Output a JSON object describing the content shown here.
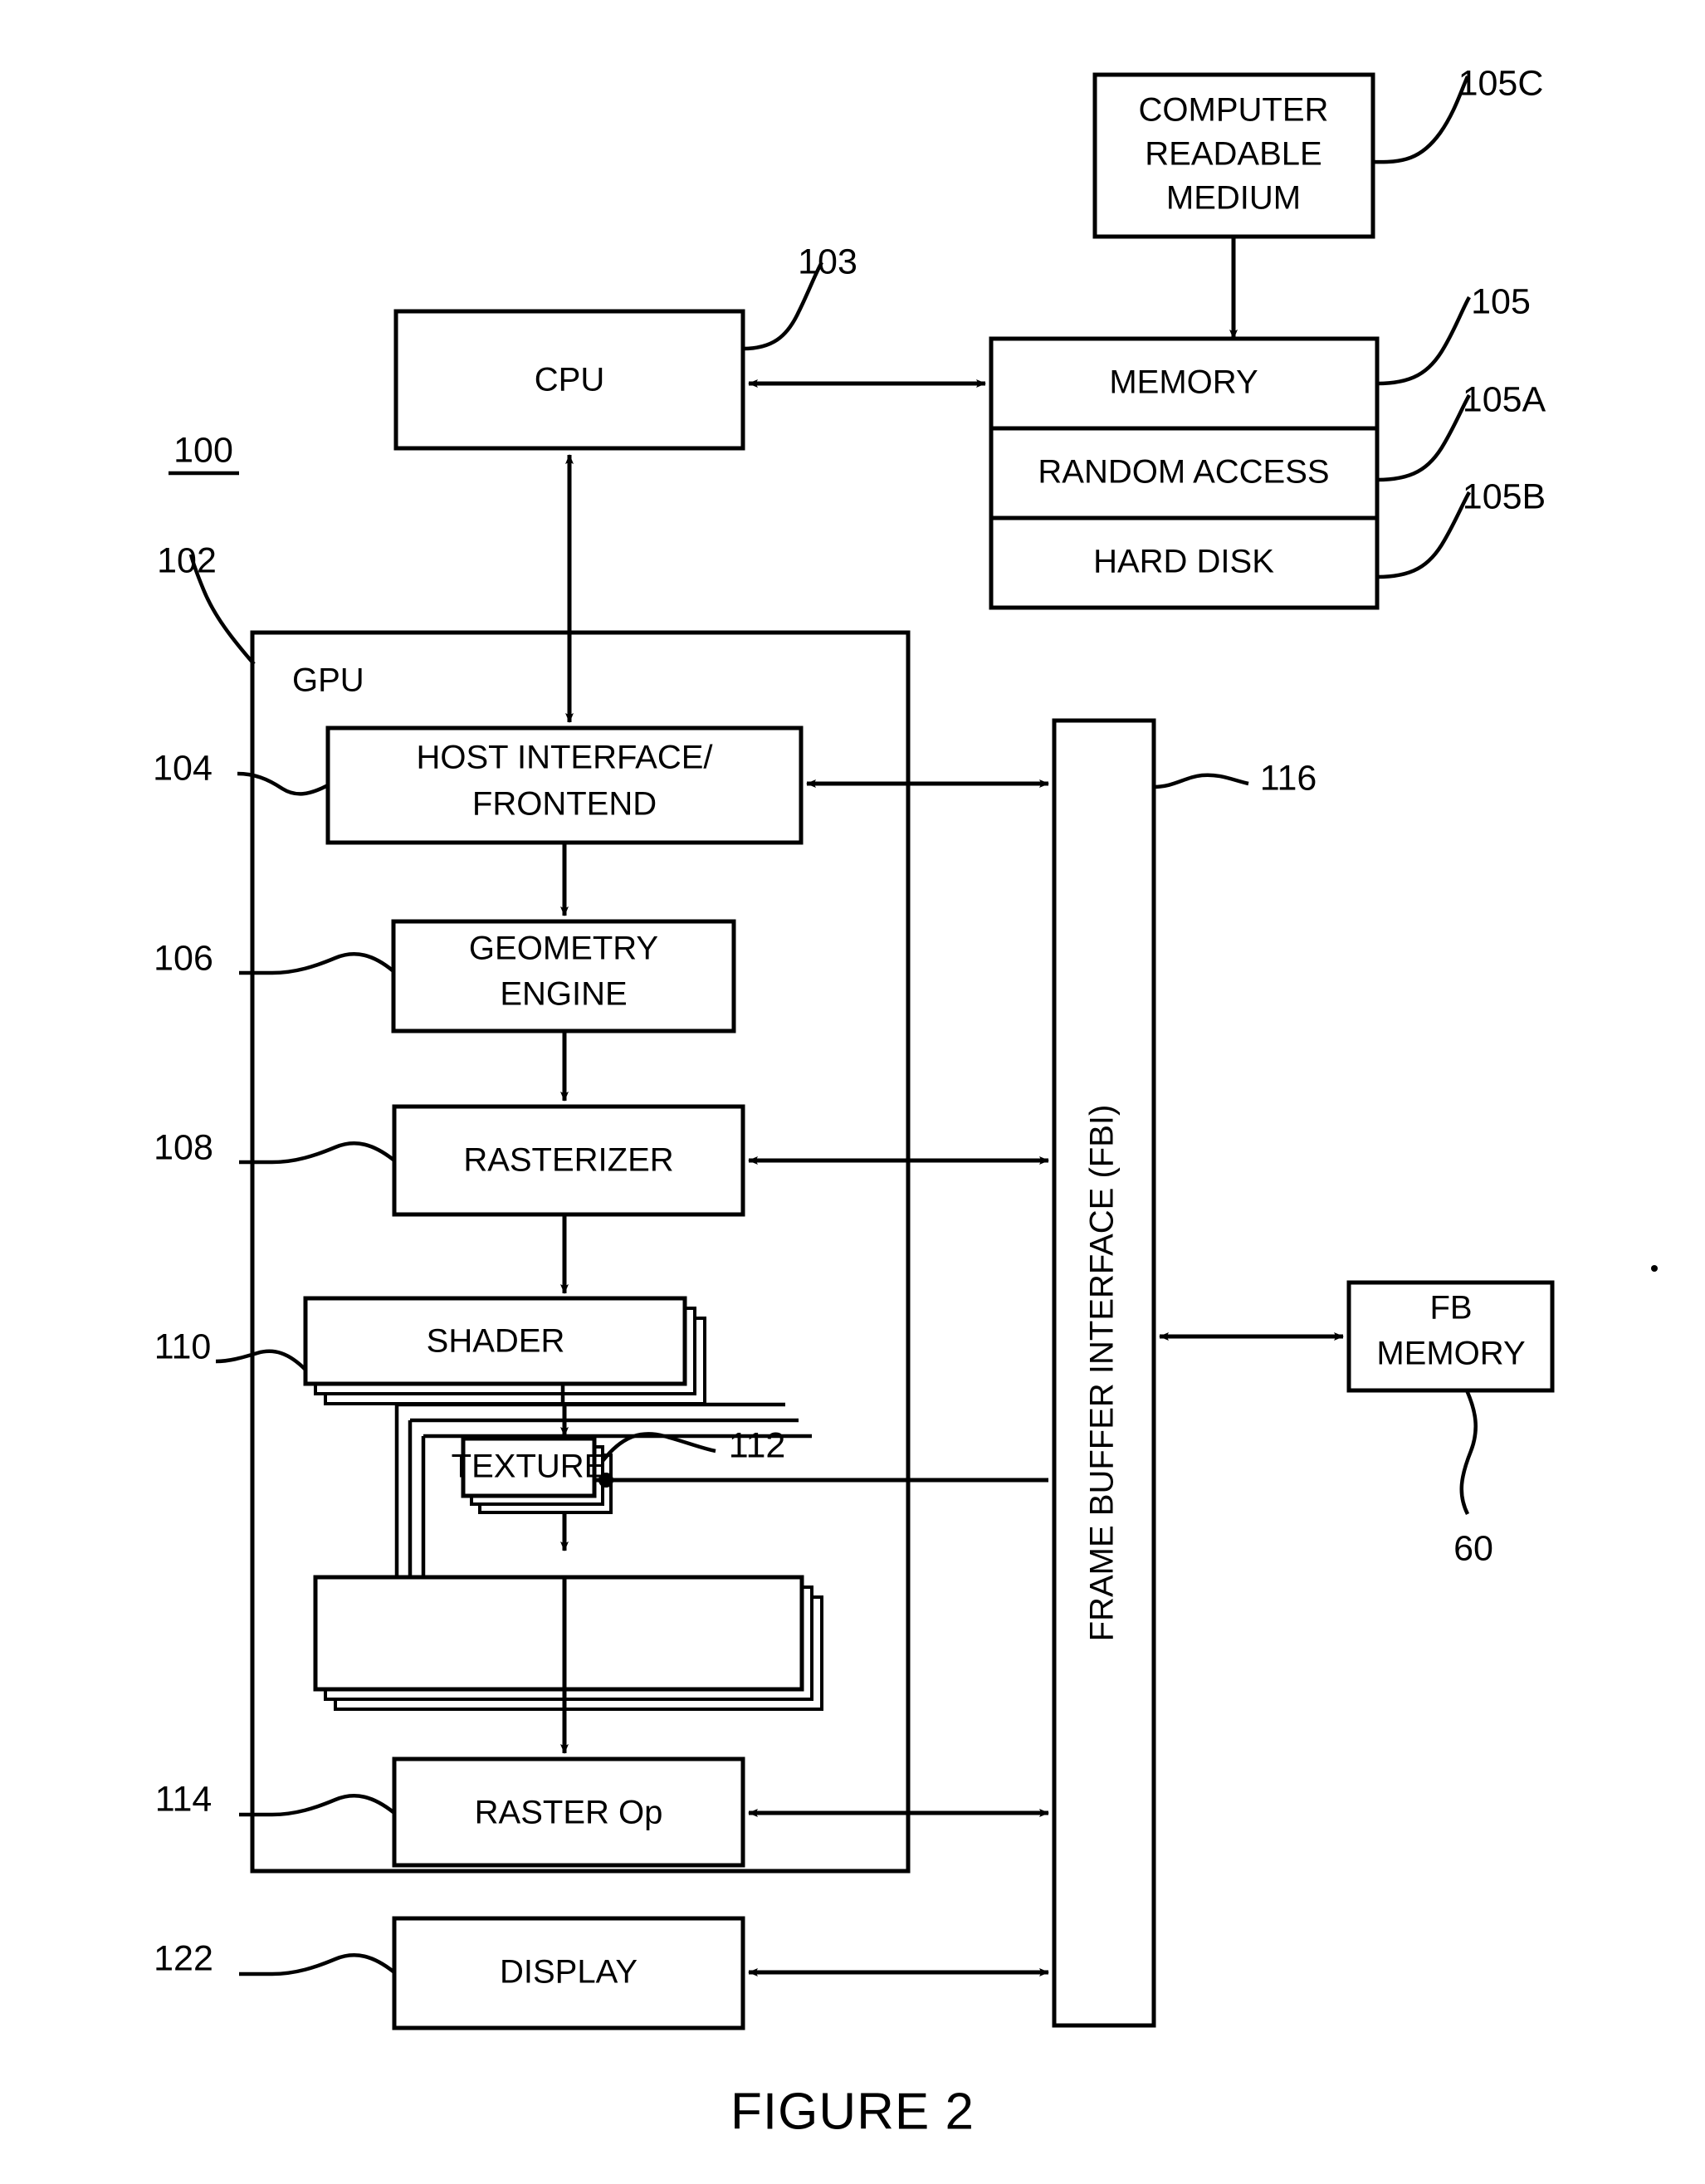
{
  "figure": {
    "caption": "FIGURE 2",
    "system_ref": "100",
    "gpu_container_label": "GPU",
    "gpu_container_ref": "102"
  },
  "blocks": {
    "computer_readable_medium": {
      "lines": [
        "COMPUTER",
        "READABLE",
        "MEDIUM"
      ],
      "ref": "105C"
    },
    "memory": {
      "label": "MEMORY",
      "ref": "105"
    },
    "random_access": {
      "label": "RANDOM ACCESS",
      "ref": "105A"
    },
    "hard_disk": {
      "label": "HARD DISK",
      "ref": "105B"
    },
    "cpu": {
      "label": "CPU",
      "ref": "103"
    },
    "host_interface": {
      "lines": [
        "HOST INTERFACE/",
        "FRONTEND"
      ],
      "ref": "104"
    },
    "geometry_engine": {
      "lines": [
        "GEOMETRY",
        "ENGINE"
      ],
      "ref": "106"
    },
    "rasterizer": {
      "label": "RASTERIZER",
      "ref": "108"
    },
    "shader": {
      "label": "SHADER",
      "ref": "110"
    },
    "texture": {
      "label": "TEXTURE",
      "ref": "112"
    },
    "raster_op": {
      "label": "RASTER Op",
      "ref": "114"
    },
    "frame_buffer_interface": {
      "label": "FRAME BUFFER INTERFACE (FBI)",
      "ref": "116"
    },
    "fb_memory": {
      "lines": [
        "FB",
        "MEMORY"
      ],
      "ref": "60"
    },
    "display": {
      "label": "DISPLAY",
      "ref": "122"
    }
  },
  "colors": {
    "ink": "#000000",
    "paper": "#ffffff"
  }
}
